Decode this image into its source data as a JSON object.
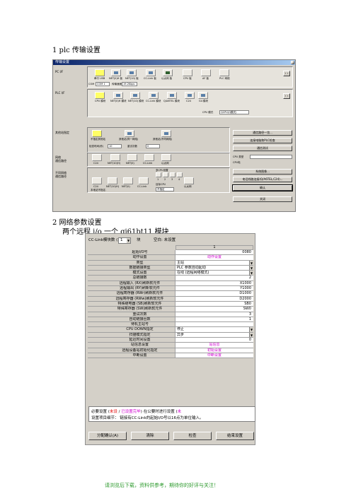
{
  "doc": {
    "heading1": "1 plc 传输设置",
    "heading2": "2 网络参数设置",
    "heading2_sub": "两个远程 i/o 一个 qj61bt11 模块",
    "footer": "请浏览后下载，资料供参考，期待你的好评与关注！"
  },
  "transfer_window": {
    "title": "传输设置",
    "sections": {
      "pc_if": "PC I/F",
      "plc_if": "PLC I/F",
      "other_station": "其他站指定",
      "network_route": "网络\n通信路径",
      "diff_network": "不同网络\n通信路径"
    },
    "pc_tiles": [
      "串行\nUSB",
      "NET(II)H\n板",
      "NET(10)\n板",
      "CC-Link\n板",
      "以太网\n板",
      "CPU\n板",
      "AF\n板",
      "PLC\n网络"
    ],
    "com_row": {
      "com_label": "COM",
      "com_value": "COM 1",
      "speed_label": "传输速度",
      "speed_value": "19.2Kbps"
    },
    "plc_tiles": [
      "CPU\n模块",
      "NET(II)H\n模块",
      "NET(10)\n模块",
      "CC-Link\n模块",
      "Q/A6TEL\n模块",
      "C24",
      "G4\n模块"
    ],
    "cpu_mode_label": "CPU 模式",
    "cpu_mode_value": "QCPU(Q模式)",
    "station_tiles": [
      "不指定其他站",
      "其他站(同一网络)",
      "其他站(不同网络)"
    ],
    "timeout": {
      "check_label": "检查时间(秒)",
      "check_value": "10",
      "retry_label": "重试次数",
      "retry_value": "0"
    },
    "net_tiles": [
      "C24",
      "NET/10(H)",
      "NET(II)",
      "CC-Link",
      "以太网"
    ],
    "diff_tiles": [
      "C24",
      "NET/10(H)",
      "NET(II)",
      "CC-Link",
      "以太网"
    ],
    "multi_cpu_label": "多CPU设置",
    "multi_cpu_numbers": [
      "1",
      "2",
      "3",
      "4"
    ],
    "target_cpu_label": "目标CPU",
    "target_cpu_value": "不指定",
    "route_label": "本地站不指定.",
    "right_buttons": [
      "通信路径一览...",
      "连接电脑和PLC检查",
      "通信测试"
    ],
    "cpu_type_label": "CPU 类型",
    "cpu_type_value": "",
    "phone_label": "CPU电",
    "system_image": "系统图像...",
    "phone_line": "电话线路连接(Q/A6TEL,C24)...",
    "ok_label": "确认",
    "close_label": "关闭"
  },
  "cclink_window": {
    "count_label": "CC-Link模块数 (块)",
    "count_value": "1",
    "count_unit": "块",
    "blank_label": "空白: 未设置",
    "column_header": "1",
    "params": [
      {
        "name": "起始I/O号",
        "value": "0080",
        "kind": "right"
      },
      {
        "name": "动作设置",
        "value": "动作设置",
        "kind": "center"
      },
      {
        "name": "类型",
        "value": "主站",
        "kind": "dd"
      },
      {
        "name": "数据链接类型",
        "value": "PLC 参数自动起动",
        "kind": "dd"
      },
      {
        "name": "模式设置",
        "value": "在线 (远程网络模式)",
        "kind": "dd"
      },
      {
        "name": "总链接数",
        "value": "2",
        "kind": "right"
      },
      {
        "name": "远程输入 (RX)刷新软元件",
        "value": "X1000",
        "kind": "right"
      },
      {
        "name": "远程输出 (RY)刷新软元件",
        "value": "Y1000",
        "kind": "right"
      },
      {
        "name": "远程寄存器 (RWr)刷新软元件",
        "value": "D1000",
        "kind": "right"
      },
      {
        "name": "远程寄存器 (RWw)刷新软元件",
        "value": "D2000",
        "kind": "right"
      },
      {
        "name": "特殊继电器 (SB)刷新软元件",
        "value": "SB0",
        "kind": "right"
      },
      {
        "name": "特殊寄存器 (SW)刷新软元件",
        "value": "SW0",
        "kind": "right"
      },
      {
        "name": "重试次数",
        "value": "3",
        "kind": "right"
      },
      {
        "name": "自动链接台数",
        "value": "1",
        "kind": "right"
      },
      {
        "name": "待机主站号",
        "value": "",
        "kind": "right"
      },
      {
        "name": "CPU DOWN指定",
        "value": "停止",
        "kind": "dd"
      },
      {
        "name": "扫描模式指定",
        "value": "异步",
        "kind": "dd"
      },
      {
        "name": "延迟时间设置",
        "value": "0",
        "kind": "right"
      },
      {
        "name": "站信息设置",
        "value": "站信息",
        "kind": "center"
      },
      {
        "name": "远程设备站初始化指定",
        "value": "初始设置",
        "kind": "center"
      },
      {
        "name": "中断设置",
        "value": "中断设置",
        "kind": "center"
      }
    ],
    "note_line1_a": "必要设置 (",
    "note_line1_b": "未设",
    "note_line1_c": " / ",
    "note_line1_d": "已设置完毕",
    "note_line1_e": ") 在公要时进行设置 (",
    "note_line1_f": "未",
    "note_line2_label": "设置项目细节：",
    "note_line2_text": "链接有CC-Link的起始I/O号以16点为单位输入。",
    "buttons": [
      "分配确认(A)",
      "清除",
      "检查",
      "结束设置"
    ]
  }
}
